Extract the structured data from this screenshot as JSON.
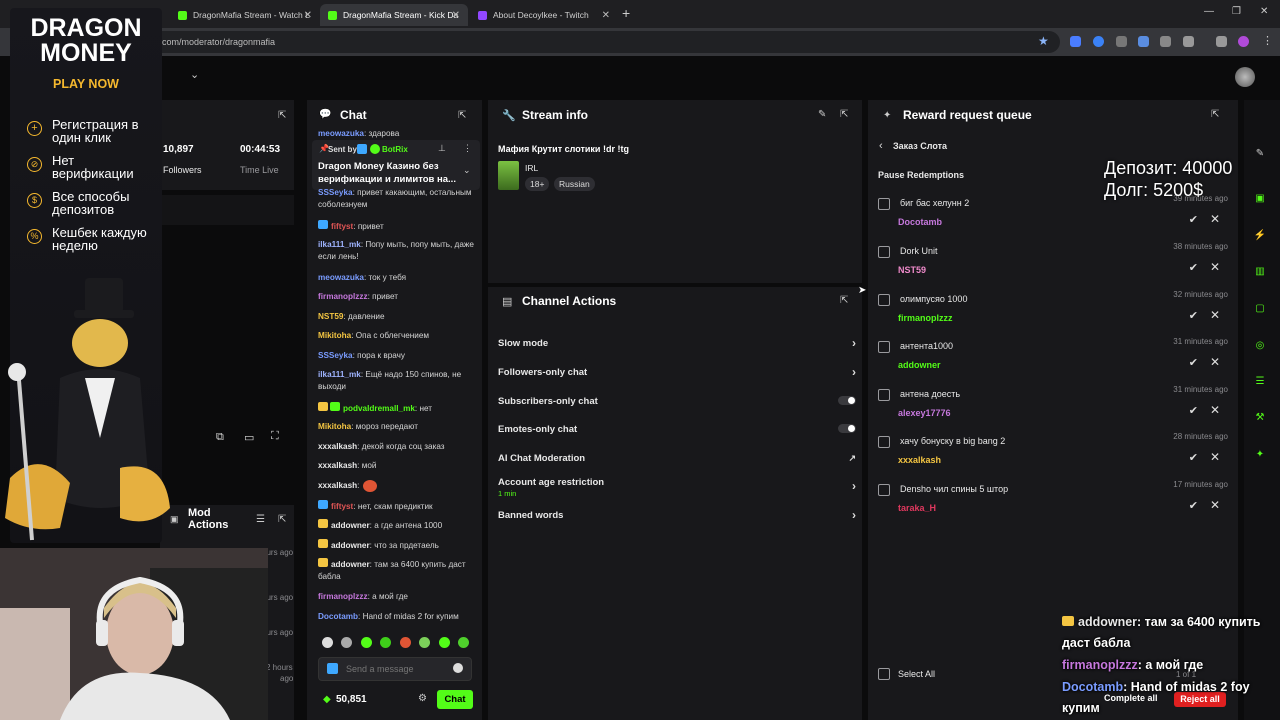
{
  "browser": {
    "tabs": [
      {
        "label": "DragonMafia Stream - Watch L",
        "active": false
      },
      {
        "label": "DragonMafia Stream - Kick Da",
        "active": true
      },
      {
        "label": "About Decoylkee - Twitch",
        "active": false
      }
    ],
    "new_tab": "+",
    "url": "com/moderator/dragonmafia"
  },
  "ad": {
    "title_line1": "DRAGON",
    "title_line2": "MONEY",
    "cta": "PLAY NOW",
    "bullets": [
      "Регистрация в один клик",
      "Нет верификации",
      "Все способы депозитов",
      "Кешбек каждую неделю"
    ]
  },
  "stats": {
    "followers_value": "10,897",
    "followers_label": "Followers",
    "time_value": "00:44:53",
    "time_label": "Time Live"
  },
  "mod_actions": {
    "title_line1": "Mod",
    "title_line2": "Actions",
    "times": [
      "ours ago",
      "ours ago",
      "ours ago",
      "2 hours",
      "ago"
    ]
  },
  "chat": {
    "title": "Chat",
    "pinned_sender_prefix": "Sent by",
    "pinned_sender": "BotRix",
    "pinned_text": "Dragon Money Казино без верификации и лимитов на...",
    "messages": [
      {
        "user": "meowazuka",
        "text": ": здарова",
        "color": "#7a9cff"
      },
      {
        "user": "SSSeyka",
        "text": ": привет какающим, остальным соболезнуем",
        "color": "#7a9cff"
      },
      {
        "user": "fiftyst",
        "text": ": привет",
        "color": "#e05555"
      },
      {
        "user": "ilka111_mk",
        "text": ": Попу мыть, попу мыть, даже если лень!",
        "color": "#9fb4ff"
      },
      {
        "user": "meowazuka",
        "text": ": ток у тебя",
        "color": "#7a9cff"
      },
      {
        "user": "firmanoplzzz",
        "text": ": привет",
        "color": "#c678dd"
      },
      {
        "user": "NST59",
        "text": ": давление",
        "color": "#f4c542"
      },
      {
        "user": "Mikitoha",
        "text": ": Опа с облегчением",
        "color": "#f4c542"
      },
      {
        "user": "SSSeyka",
        "text": ": пора к врачу",
        "color": "#7a9cff"
      },
      {
        "user": "ilka111_mk",
        "text": ": Ещё надо 150 спинов, не выходи",
        "color": "#9fb4ff"
      },
      {
        "user": "podvaldremall_mk",
        "text": ": нет",
        "color": "#53fc18"
      },
      {
        "user": "Mikitoha",
        "text": ": мороз передают",
        "color": "#f4c542"
      },
      {
        "user": "xxxalkash",
        "text": ": декой когда соц заказ",
        "color": "#e8e8e8"
      },
      {
        "user": "xxxalkash",
        "text": ": мой",
        "color": "#e8e8e8"
      },
      {
        "user": "xxxalkash",
        "text": ":",
        "color": "#e8e8e8"
      },
      {
        "user": "fiftyst",
        "text": ": нет, скам предиктик",
        "color": "#e05555"
      },
      {
        "user": "addowner",
        "text": ": а где антена 1000",
        "color": "#e8e8e8"
      },
      {
        "user": "addowner",
        "text": ": что за прдетаель",
        "color": "#e8e8e8"
      },
      {
        "user": "addowner",
        "text": ": там за 6400 купить даст бабла",
        "color": "#e8e8e8"
      },
      {
        "user": "firmanoplzzz",
        "text": ": а мой где",
        "color": "#c678dd"
      },
      {
        "user": "Docotamb",
        "text": ": Hand of midas 2 for купим",
        "color": "#7a9cff"
      }
    ],
    "input_placeholder": "Send a message",
    "points": "50,851",
    "send_label": "Chat"
  },
  "stream_info": {
    "title": "Stream info",
    "stream_title": "Мафия Крутит слотики !dr !tg",
    "category": "IRL",
    "tags": [
      "18+",
      "Russian"
    ]
  },
  "channel_actions": {
    "title": "Channel Actions",
    "rows": [
      {
        "label": "Slow mode",
        "control": "arrow"
      },
      {
        "label": "Followers-only chat",
        "control": "arrow"
      },
      {
        "label": "Subscribers-only chat",
        "control": "toggle"
      },
      {
        "label": "Emotes-only chat",
        "control": "toggle"
      },
      {
        "label": "AI Chat Moderation",
        "control": "external"
      },
      {
        "label": "Account age restriction",
        "sub": "1 min",
        "control": "arrow"
      },
      {
        "label": "Banned words",
        "control": "arrow"
      }
    ]
  },
  "reward_queue": {
    "title": "Reward request queue",
    "back_label": "Заказ Слота",
    "pause_label": "Pause Redemptions",
    "items": [
      {
        "title": "биг бас хелунн 2",
        "user": "Docotamb",
        "user_color": "#c678dd",
        "time": "39 minutes ago"
      },
      {
        "title": "Dork Unit",
        "user": "NST59",
        "user_color": "#f08acb",
        "time": "38 minutes ago"
      },
      {
        "title": "олимпусяо 1000",
        "user": "firmanoplzzz",
        "user_color": "#53fc18",
        "time": "32 minutes ago"
      },
      {
        "title": "антента1000",
        "user": "addowner",
        "user_color": "#53fc18",
        "time": "31 minutes ago"
      },
      {
        "title": "антена доесть",
        "user": "alexey17776",
        "user_color": "#c678dd",
        "time": "31 minutes ago"
      },
      {
        "title": "хачу бонуску в big bang 2",
        "user": "xxxalkash",
        "user_color": "#f4c542",
        "time": "28 minutes ago"
      },
      {
        "title": "Densho чил спины 5 штор",
        "user": "taraka_H",
        "user_color": "#e0385e",
        "time": "17 minutes ago"
      }
    ],
    "select_all": "Select All",
    "page_info": "1 of 1",
    "complete_all": "Complete all",
    "reject_all": "Reject all"
  },
  "overlay": {
    "deposit": "Депозит: 40000",
    "debt": "Долг: 5200$",
    "chat": [
      {
        "user": "addowner",
        "text": ": там за 6400 купить",
        "cont": "даст бабла",
        "color": "#e8e8e8"
      },
      {
        "user": "firmanoplzzz",
        "text": ": а мой где",
        "cont": "",
        "color": "#c678dd"
      },
      {
        "user": "Docotamb",
        "text": ": Hand of midas 2 foy",
        "cont": "купим",
        "color": "#7a9cff"
      }
    ]
  },
  "colors": {
    "kick_green": "#53fc18",
    "panel": "#18181b",
    "reject": "#e02020"
  }
}
